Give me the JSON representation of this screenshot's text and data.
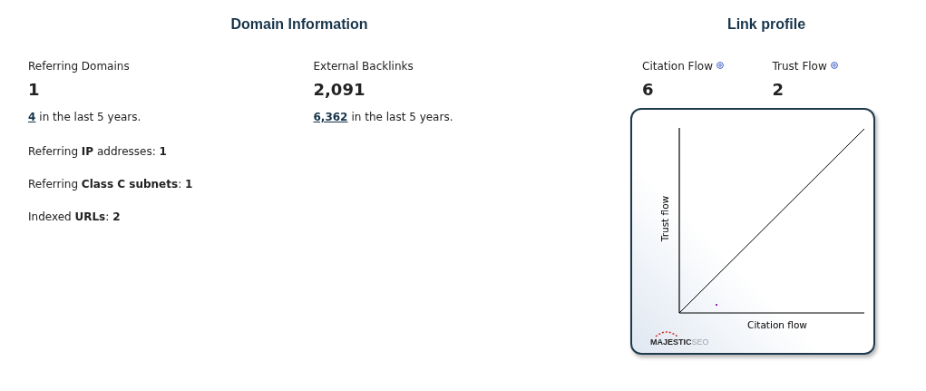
{
  "domain_information": {
    "title": "Domain Information",
    "columns": [
      {
        "label": "Referring Domains",
        "value": "1",
        "history_link": "4",
        "history_text": "in the last 5 years.",
        "details": [
          "Referring **IP** addresses: **1**",
          "Referring **Class C subnets**: **1**",
          "Indexed **URLs**: **2**"
        ]
      },
      {
        "label": "External Backlinks",
        "value": "2,091",
        "history_link": "6,362",
        "history_text": "in the last 5 years."
      }
    ]
  },
  "link_profile": {
    "title": "Link profile",
    "metrics": [
      {
        "label": "Citation Flow",
        "value": "6"
      },
      {
        "label": "Trust Flow",
        "value": "2"
      }
    ],
    "chart": {
      "ylabel": "Trust flow",
      "xlabel": "Citation flow",
      "logo": [
        "MAJESTIC",
        "SEO"
      ]
    }
  }
}
